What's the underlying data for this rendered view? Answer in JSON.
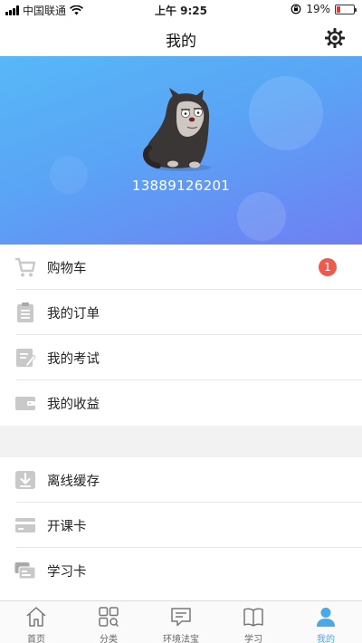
{
  "status_bar": {
    "carrier": "中国联通",
    "time": "上午 9:25",
    "battery_percent": "19%",
    "battery_level": 0.19
  },
  "header": {
    "title": "我的",
    "settings_icon": "gear-icon"
  },
  "profile": {
    "phone": "13889126201",
    "avatar_icon": "cat-avatar"
  },
  "menu_group_1": [
    {
      "label": "购物车",
      "icon": "cart-icon",
      "badge": "1"
    },
    {
      "label": "我的订单",
      "icon": "clipboard-icon"
    },
    {
      "label": "我的考试",
      "icon": "exam-icon"
    },
    {
      "label": "我的收益",
      "icon": "wallet-icon"
    }
  ],
  "menu_group_2": [
    {
      "label": "离线缓存",
      "icon": "download-icon"
    },
    {
      "label": "开课卡",
      "icon": "card-icon"
    },
    {
      "label": "学习卡",
      "icon": "cards-icon"
    }
  ],
  "tabs": [
    {
      "label": "首页",
      "icon": "home-icon"
    },
    {
      "label": "分类",
      "icon": "grid-icon"
    },
    {
      "label": "环境法宝",
      "icon": "chat-icon"
    },
    {
      "label": "学习",
      "icon": "book-icon"
    },
    {
      "label": "我的",
      "icon": "user-icon",
      "active": true
    }
  ],
  "colors": {
    "accent": "#4aa7e8",
    "badge": "#ef5a4f",
    "hero_start": "#57b8f7",
    "hero_end": "#6f7ff2",
    "icon_gray": "#c9c9c9"
  }
}
